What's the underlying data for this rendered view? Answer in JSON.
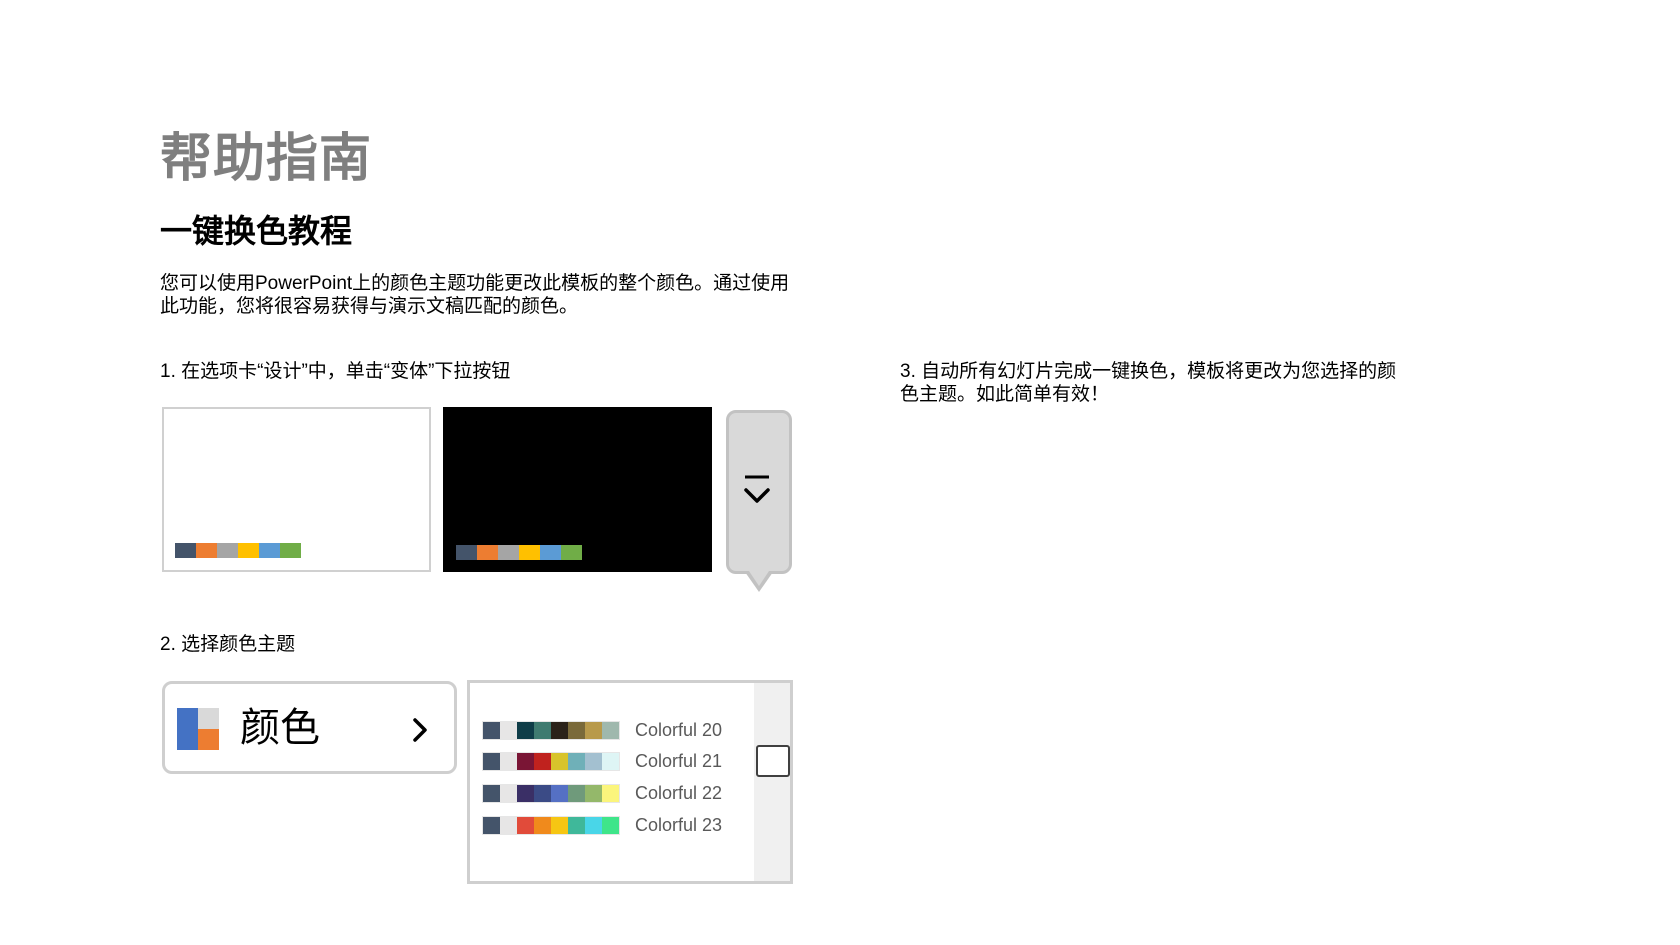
{
  "header": {
    "title": "帮助指南",
    "subtitle": "一键换色教程",
    "description": "您可以使用PowerPoint上的颜色主题功能更改此模板的整个颜色。通过使用此功能，您将很容易获得与演示文稿匹配的颜色。"
  },
  "steps": {
    "step1": "1. 在选项卡“设计”中，单击“变体”下拉按钮",
    "step2": "2. 选择颜色主题",
    "step3": "3. 自动所有幻灯片完成一键换色，模板将更改为您选择的颜色主题。如此简单有效！"
  },
  "variants": [
    {
      "background": "#ffffff",
      "swatches": [
        "#44546a",
        "#ed7d31",
        "#a5a5a5",
        "#ffc000",
        "#5b9bd5",
        "#70ad47"
      ]
    },
    {
      "background": "#000000",
      "swatches": [
        "#44546a",
        "#ed7d31",
        "#a5a5a5",
        "#ffc000",
        "#5b9bd5",
        "#70ad47"
      ]
    }
  ],
  "dropdown": {
    "icon": "expand-more-icon"
  },
  "colors_button": {
    "label": "颜色",
    "icon": "color-palette-icon",
    "chevron": "chevron-right-icon",
    "icon_colors": [
      "#4472c4",
      "#d9d9d9",
      "#ed7d31"
    ]
  },
  "theme_list": {
    "items": [
      {
        "name": "Colorful 20",
        "swatches": [
          "#44546a",
          "#e7e6e6",
          "#0f3d48",
          "#3f7b70",
          "#2a2219",
          "#7a6a3a",
          "#b89a4b",
          "#9fb8ad"
        ]
      },
      {
        "name": "Colorful 21",
        "swatches": [
          "#44546a",
          "#e7e6e6",
          "#7a1535",
          "#c0221e",
          "#d8c42b",
          "#6fb0b8",
          "#a3c0d0",
          "#def5f5"
        ]
      },
      {
        "name": "Colorful 22",
        "swatches": [
          "#44546a",
          "#e7e6e6",
          "#3a2f66",
          "#3b4b86",
          "#5570c4",
          "#6f9a7b",
          "#94b86a",
          "#fbf57c"
        ]
      },
      {
        "name": "Colorful 23",
        "swatches": [
          "#44546a",
          "#e7e6e6",
          "#e14b3a",
          "#f08a1c",
          "#f6c613",
          "#3fb89a",
          "#49d6e8",
          "#3fe58a"
        ]
      }
    ]
  }
}
